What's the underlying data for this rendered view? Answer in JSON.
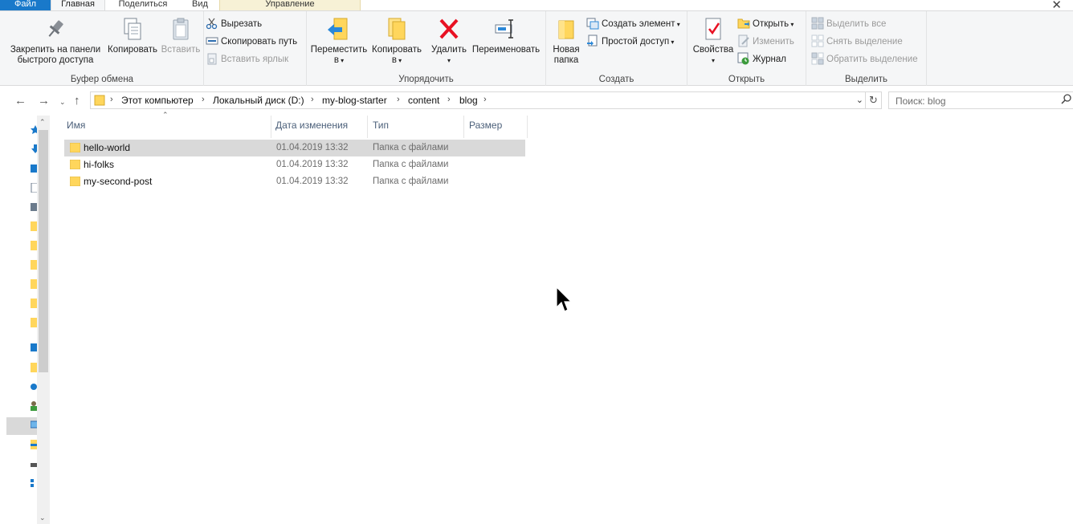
{
  "ribbon_tabs": {
    "file": "Файл",
    "home": "Главная",
    "share": "Поделиться",
    "view": "Вид",
    "manage": "Управление"
  },
  "clipboard": {
    "pin": "Закрепить на панели быстрого доступа",
    "copy": "Копировать",
    "paste": "Вставить",
    "cut": "Вырезать",
    "copy_path": "Скопировать путь",
    "paste_shortcut": "Вставить ярлык",
    "label": "Буфер обмена"
  },
  "organize": {
    "move": "Переместить в",
    "copy_to": "Копировать в",
    "delete": "Удалить",
    "rename": "Переименовать",
    "label": "Упорядочить"
  },
  "create": {
    "new_folder": "Новая папка",
    "new_item": "Создать элемент",
    "easy_access": "Простой доступ",
    "label": "Создать"
  },
  "open": {
    "properties": "Свойства",
    "open": "Открыть",
    "edit": "Изменить",
    "history": "Журнал",
    "label": "Открыть"
  },
  "select": {
    "select_all": "Выделить все",
    "select_none": "Снять выделение",
    "invert": "Обратить выделение",
    "label": "Выделить"
  },
  "address": {
    "crumbs": [
      "Этот компьютер",
      "Локальный диск (D:)",
      "my-blog-starter",
      "content",
      "blog"
    ]
  },
  "search": {
    "placeholder": "Поиск: blog"
  },
  "columns": {
    "name": "Имя",
    "date": "Дата изменения",
    "type": "Тип",
    "size": "Размер"
  },
  "files": [
    {
      "name": "hello-world",
      "date": "01.04.2019 13:32",
      "type": "Папка с файлами",
      "selected": true
    },
    {
      "name": "hi-folks",
      "date": "01.04.2019 13:32",
      "type": "Папка с файлами",
      "selected": false
    },
    {
      "name": "my-second-post",
      "date": "01.04.2019 13:32",
      "type": "Папка с файлами",
      "selected": false
    }
  ],
  "colors": {
    "file_tab": "#1979ca",
    "folder": "#ffd65c",
    "selection": "#d9d9d9",
    "delete_red": "#e81123"
  }
}
